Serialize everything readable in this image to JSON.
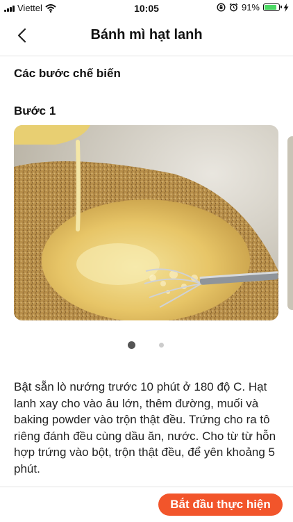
{
  "status_bar": {
    "carrier": "Viettel",
    "time": "10:05",
    "battery_percent": "91%",
    "battery_level": 0.91,
    "icons": [
      "signal-icon",
      "wifi-icon",
      "orientation-lock-icon",
      "alarm-icon",
      "battery-icon",
      "charging-icon"
    ]
  },
  "nav": {
    "back_icon": "chevron-left-icon",
    "title": "Bánh mì hạt lanh"
  },
  "content": {
    "section_title": "Các bước chế biến",
    "step_title": "Bước 1",
    "carousel": {
      "page_count": 2,
      "active_index": 0
    },
    "description": "Bật sẵn lò nướng trước 10 phút ở 180 độ C. Hạt lanh xay cho vào âu lớn, thêm đường, muối và baking powder vào trộn thật đều. Trứng cho ra tô riêng đánh đều cùng dầu ăn, nước. Cho từ từ hỗn hợp trứng vào bột, trộn thật đều, để yên khoảng 5 phút."
  },
  "footer": {
    "start_button": "Bắt đầu thực hiện"
  },
  "colors": {
    "accent": "#f2552b",
    "battery": "#4cd964"
  }
}
